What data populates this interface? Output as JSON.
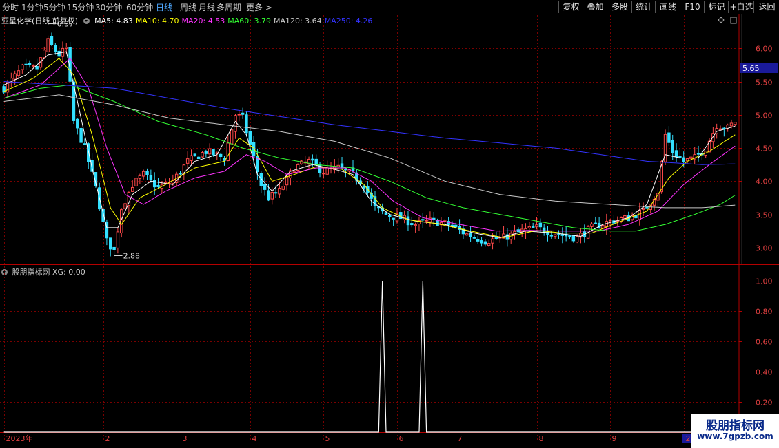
{
  "toolbar": {
    "tabs": [
      "分时",
      "1分钟",
      "5分钟",
      "15分钟",
      "30分钟",
      "60分钟",
      "日线",
      "周线",
      "月线",
      "多周期",
      "更多 >"
    ],
    "active_tab": "日线",
    "right_buttons": [
      "复权",
      "叠加",
      "多股",
      "统计",
      "画线",
      "F10",
      "标记",
      "+自选",
      "返回"
    ]
  },
  "stock": {
    "title": "亚星化学(日线 前复权)",
    "ma_labels": [
      {
        "label": "MA5: 4.83",
        "color": "#ffffff"
      },
      {
        "label": "MA10: 4.70",
        "color": "#ffff00"
      },
      {
        "label": "MA20: 4.53",
        "color": "#ff33ff"
      },
      {
        "label": "MA60: 3.79",
        "color": "#33ff33"
      },
      {
        "label": "MA120: 3.64",
        "color": "#c8c8c8"
      },
      {
        "label": "MA250: 4.26",
        "color": "#3333ff"
      }
    ],
    "current_price": "5.65",
    "high_annotation": "6.37",
    "low_annotation": "2.88"
  },
  "indicator": {
    "label": "股朋指标网 XG: 0.00"
  },
  "watermark": {
    "title": "股朋指标网",
    "url": "www.7gpzb.com"
  },
  "colors": {
    "up": "#ff4a4a",
    "down": "#33e0ff",
    "grid": "#7a0000",
    "axis": "#b40000"
  },
  "chart_data": [
    {
      "type": "candlestick",
      "ylim": [
        2.75,
        6.5
      ],
      "yticks": [
        "6.00",
        "5.50",
        "5.00",
        "4.50",
        "4.00",
        "3.50",
        "3.00"
      ],
      "ytick_values": [
        6.0,
        5.5,
        5.0,
        4.5,
        4.0,
        3.5,
        3.0
      ],
      "xticks": [
        "2023年",
        "2",
        "3",
        "4",
        "5",
        "6",
        "7",
        "8",
        "9",
        "2024"
      ],
      "xtick_index": [
        0,
        27,
        48,
        67,
        87,
        107,
        123,
        145,
        165,
        185
      ],
      "candle_count": 200,
      "close_path": [
        [
          0,
          5.4
        ],
        [
          5,
          5.7
        ],
        [
          9,
          5.7
        ],
        [
          12,
          6.1
        ],
        [
          15,
          5.9
        ],
        [
          17,
          6.0
        ],
        [
          19,
          4.9
        ],
        [
          22,
          4.5
        ],
        [
          25,
          3.9
        ],
        [
          28,
          3.1
        ],
        [
          30,
          2.95
        ],
        [
          32,
          3.6
        ],
        [
          35,
          3.95
        ],
        [
          38,
          4.1
        ],
        [
          42,
          3.9
        ],
        [
          46,
          4.0
        ],
        [
          50,
          4.3
        ],
        [
          55,
          4.45
        ],
        [
          60,
          4.35
        ],
        [
          63,
          5.0
        ],
        [
          65,
          4.95
        ],
        [
          67,
          4.55
        ],
        [
          70,
          3.95
        ],
        [
          72,
          3.75
        ],
        [
          75,
          3.85
        ],
        [
          79,
          4.2
        ],
        [
          83,
          4.3
        ],
        [
          87,
          4.15
        ],
        [
          91,
          4.2
        ],
        [
          95,
          4.1
        ],
        [
          98,
          3.95
        ],
        [
          101,
          3.6
        ],
        [
          104,
          3.5
        ],
        [
          108,
          3.45
        ],
        [
          112,
          3.35
        ],
        [
          116,
          3.4
        ],
        [
          121,
          3.35
        ],
        [
          126,
          3.2
        ],
        [
          131,
          3.1
        ],
        [
          136,
          3.15
        ],
        [
          141,
          3.25
        ],
        [
          145,
          3.3
        ],
        [
          151,
          3.2
        ],
        [
          156,
          3.15
        ],
        [
          160,
          3.3
        ],
        [
          165,
          3.4
        ],
        [
          170,
          3.45
        ],
        [
          174,
          3.55
        ],
        [
          178,
          3.85
        ],
        [
          180,
          4.7
        ],
        [
          182,
          4.45
        ],
        [
          185,
          4.3
        ],
        [
          188,
          4.35
        ],
        [
          191,
          4.5
        ],
        [
          194,
          4.85
        ],
        [
          197,
          4.8
        ],
        [
          199,
          4.9
        ]
      ],
      "ma_lines": [
        {
          "name": "MA5",
          "color": "#ffffff",
          "points": [
            [
              0,
              5.45
            ],
            [
              6,
              5.6
            ],
            [
              12,
              5.9
            ],
            [
              17,
              5.95
            ],
            [
              20,
              5.2
            ],
            [
              24,
              4.2
            ],
            [
              28,
              3.3
            ],
            [
              31,
              3.3
            ],
            [
              35,
              3.8
            ],
            [
              40,
              4.0
            ],
            [
              46,
              3.95
            ],
            [
              52,
              4.3
            ],
            [
              58,
              4.4
            ],
            [
              63,
              4.9
            ],
            [
              66,
              4.7
            ],
            [
              69,
              4.1
            ],
            [
              73,
              3.85
            ],
            [
              78,
              4.15
            ],
            [
              84,
              4.25
            ],
            [
              90,
              4.18
            ],
            [
              95,
              4.1
            ],
            [
              100,
              3.7
            ],
            [
              105,
              3.5
            ],
            [
              112,
              3.4
            ],
            [
              120,
              3.35
            ],
            [
              128,
              3.22
            ],
            [
              135,
              3.15
            ],
            [
              142,
              3.25
            ],
            [
              150,
              3.22
            ],
            [
              157,
              3.17
            ],
            [
              163,
              3.35
            ],
            [
              170,
              3.45
            ],
            [
              175,
              3.65
            ],
            [
              180,
              4.4
            ],
            [
              184,
              4.35
            ],
            [
              189,
              4.35
            ],
            [
              194,
              4.75
            ],
            [
              199,
              4.83
            ]
          ]
        },
        {
          "name": "MA10",
          "color": "#ffff00",
          "points": [
            [
              0,
              5.35
            ],
            [
              8,
              5.55
            ],
            [
              15,
              5.85
            ],
            [
              19,
              5.6
            ],
            [
              24,
              4.7
            ],
            [
              29,
              3.6
            ],
            [
              32,
              3.35
            ],
            [
              37,
              3.75
            ],
            [
              44,
              3.95
            ],
            [
              52,
              4.2
            ],
            [
              60,
              4.3
            ],
            [
              64,
              4.65
            ],
            [
              68,
              4.5
            ],
            [
              73,
              4.0
            ],
            [
              79,
              4.1
            ],
            [
              85,
              4.22
            ],
            [
              92,
              4.18
            ],
            [
              98,
              3.95
            ],
            [
              103,
              3.6
            ],
            [
              110,
              3.42
            ],
            [
              118,
              3.36
            ],
            [
              127,
              3.25
            ],
            [
              136,
              3.15
            ],
            [
              145,
              3.26
            ],
            [
              152,
              3.22
            ],
            [
              160,
              3.22
            ],
            [
              168,
              3.4
            ],
            [
              175,
              3.55
            ],
            [
              181,
              4.05
            ],
            [
              186,
              4.3
            ],
            [
              192,
              4.45
            ],
            [
              199,
              4.7
            ]
          ]
        },
        {
          "name": "MA20",
          "color": "#ff33ff",
          "points": [
            [
              0,
              5.25
            ],
            [
              10,
              5.45
            ],
            [
              18,
              5.85
            ],
            [
              23,
              5.4
            ],
            [
              28,
              4.5
            ],
            [
              33,
              3.8
            ],
            [
              38,
              3.65
            ],
            [
              44,
              3.85
            ],
            [
              52,
              4.05
            ],
            [
              60,
              4.15
            ],
            [
              66,
              4.4
            ],
            [
              71,
              4.3
            ],
            [
              77,
              4.1
            ],
            [
              85,
              4.2
            ],
            [
              93,
              4.2
            ],
            [
              100,
              4.0
            ],
            [
              106,
              3.7
            ],
            [
              114,
              3.45
            ],
            [
              124,
              3.35
            ],
            [
              134,
              3.25
            ],
            [
              143,
              3.26
            ],
            [
              152,
              3.25
            ],
            [
              162,
              3.25
            ],
            [
              170,
              3.35
            ],
            [
              178,
              3.55
            ],
            [
              185,
              3.95
            ],
            [
              192,
              4.25
            ],
            [
              199,
              4.53
            ]
          ]
        },
        {
          "name": "MA60",
          "color": "#33ff33",
          "points": [
            [
              0,
              5.25
            ],
            [
              10,
              5.4
            ],
            [
              18,
              5.45
            ],
            [
              30,
              5.2
            ],
            [
              42,
              4.9
            ],
            [
              55,
              4.7
            ],
            [
              65,
              4.5
            ],
            [
              75,
              4.35
            ],
            [
              85,
              4.25
            ],
            [
              95,
              4.2
            ],
            [
              105,
              4.0
            ],
            [
              115,
              3.75
            ],
            [
              125,
              3.6
            ],
            [
              135,
              3.5
            ],
            [
              145,
              3.4
            ],
            [
              155,
              3.3
            ],
            [
              165,
              3.25
            ],
            [
              172,
              3.25
            ],
            [
              180,
              3.35
            ],
            [
              188,
              3.5
            ],
            [
              195,
              3.65
            ],
            [
              199,
              3.79
            ]
          ]
        },
        {
          "name": "MA120",
          "color": "#c8c8c8",
          "points": [
            [
              0,
              5.2
            ],
            [
              15,
              5.3
            ],
            [
              30,
              5.15
            ],
            [
              45,
              4.95
            ],
            [
              60,
              4.85
            ],
            [
              75,
              4.75
            ],
            [
              90,
              4.6
            ],
            [
              105,
              4.35
            ],
            [
              120,
              4.0
            ],
            [
              135,
              3.8
            ],
            [
              150,
              3.7
            ],
            [
              165,
              3.65
            ],
            [
              180,
              3.6
            ],
            [
              190,
              3.6
            ],
            [
              199,
              3.64
            ]
          ]
        },
        {
          "name": "MA250",
          "color": "#3333ff",
          "points": [
            [
              0,
              5.5
            ],
            [
              30,
              5.4
            ],
            [
              60,
              5.1
            ],
            [
              90,
              4.85
            ],
            [
              120,
              4.65
            ],
            [
              150,
              4.5
            ],
            [
              175,
              4.3
            ],
            [
              190,
              4.25
            ],
            [
              199,
              4.26
            ]
          ]
        }
      ]
    },
    {
      "type": "line",
      "series_label": "XG",
      "ylim": [
        0,
        1.1
      ],
      "yticks": [
        "1.00",
        "0.80",
        "0.60",
        "0.40",
        "0.20"
      ],
      "ytick_values": [
        1.0,
        0.8,
        0.6,
        0.4,
        0.2
      ],
      "points": [
        [
          0,
          0
        ],
        [
          102,
          0
        ],
        [
          103,
          1
        ],
        [
          104,
          0
        ],
        [
          113,
          0
        ],
        [
          114,
          1
        ],
        [
          115,
          0
        ],
        [
          199,
          0
        ]
      ]
    }
  ]
}
